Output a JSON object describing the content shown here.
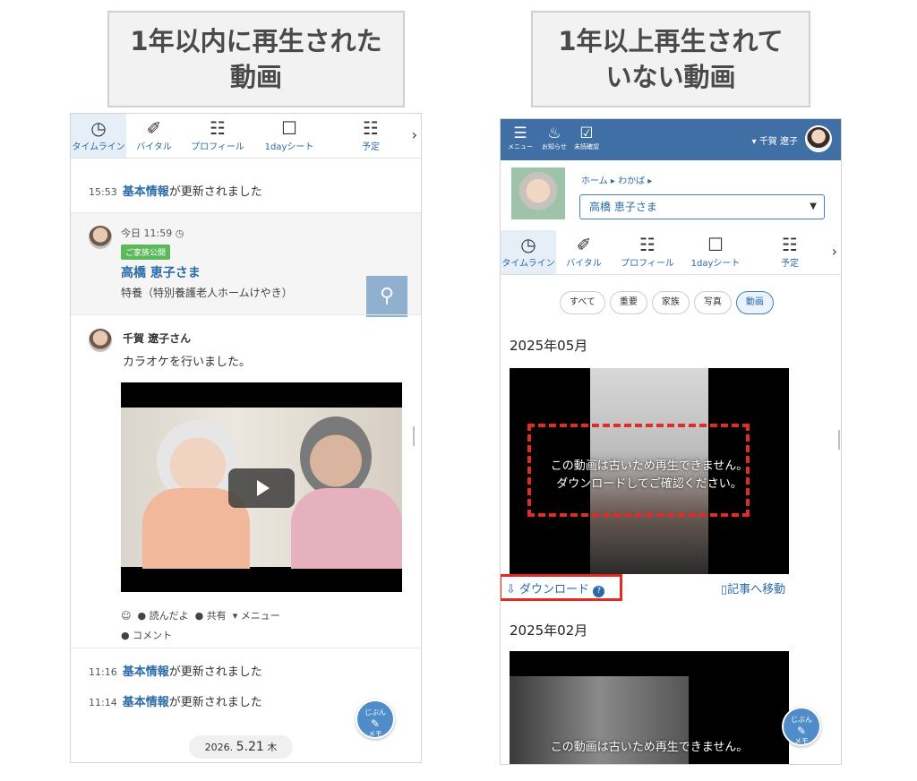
{
  "titles": {
    "left_line1": "1年以内に再生された",
    "left_line2": "動画",
    "right_line1": "1年以上再生されて",
    "right_line2": "いない動画"
  },
  "left": {
    "tabs": [
      {
        "icon": "clock-icon",
        "glyph": "◷",
        "label": "タイムライン"
      },
      {
        "icon": "vital-pen-icon",
        "glyph": "✐",
        "label": "バイタル"
      },
      {
        "icon": "profile-card-icon",
        "glyph": "☷",
        "label": "プロフィール"
      },
      {
        "icon": "clipboard-icon",
        "glyph": "☐",
        "label": "1dayシート"
      },
      {
        "icon": "calendar-icon",
        "glyph": "☷",
        "label": "予定"
      }
    ],
    "update1": {
      "time": "15:53",
      "link": "基本情報",
      "text": "が更新されました"
    },
    "post1": {
      "time": "今日 11:59",
      "badge": "ご家族公開",
      "name": "高橋 恵子さま",
      "facility": "特養（特別養護老人ホームけやき）"
    },
    "post2": {
      "author": "千賀 遼子さん",
      "text": "カラオケを行いました。",
      "actions": [
        "読んだよ",
        "共有",
        "メニュー"
      ],
      "comment": "コメント"
    },
    "update2": {
      "time": "11:16",
      "link": "基本情報",
      "text": "が更新されました"
    },
    "update3": {
      "time": "11:14",
      "link": "基本情報",
      "text": "が更新されました"
    },
    "date_pill": {
      "year": "2026.",
      "date": "5.21",
      "weekday": "木"
    },
    "fab": {
      "top": "じぶん",
      "bottom": "メモ"
    }
  },
  "right": {
    "topbar": {
      "menu": "メニュー",
      "notice": "お知らせ",
      "unread": "未読確認",
      "user": "千賀 遼子"
    },
    "breadcrumb": "ホーム ▸ わかば ▸",
    "resident": "高橋 恵子さま",
    "tabs": [
      {
        "icon": "clock-icon",
        "glyph": "◷",
        "label": "タイムライン"
      },
      {
        "icon": "vital-pen-icon",
        "glyph": "✐",
        "label": "バイタル"
      },
      {
        "icon": "profile-card-icon",
        "glyph": "☷",
        "label": "プロフィール"
      },
      {
        "icon": "clipboard-icon",
        "glyph": "☐",
        "label": "1dayシート"
      },
      {
        "icon": "calendar-icon",
        "glyph": "☷",
        "label": "予定"
      }
    ],
    "filters": [
      "すべて",
      "重要",
      "家族",
      "写真",
      "動画"
    ],
    "month1": "2025年05月",
    "message_line1": "この動画は古いため再生できません。",
    "message_line2": "ダウンロードしてご確認ください。",
    "download": "ダウンロード",
    "goto_article": "記事へ移動",
    "month2": "2025年02月",
    "message2_line1": "この動画は古いため再生できません。",
    "fab": {
      "top": "じぶん",
      "bottom": "メモ"
    }
  },
  "colors": {
    "accent": "#3f6fa5",
    "link": "#2b6aa8",
    "highlight": "#e32a23",
    "badge": "#5bb85b"
  }
}
